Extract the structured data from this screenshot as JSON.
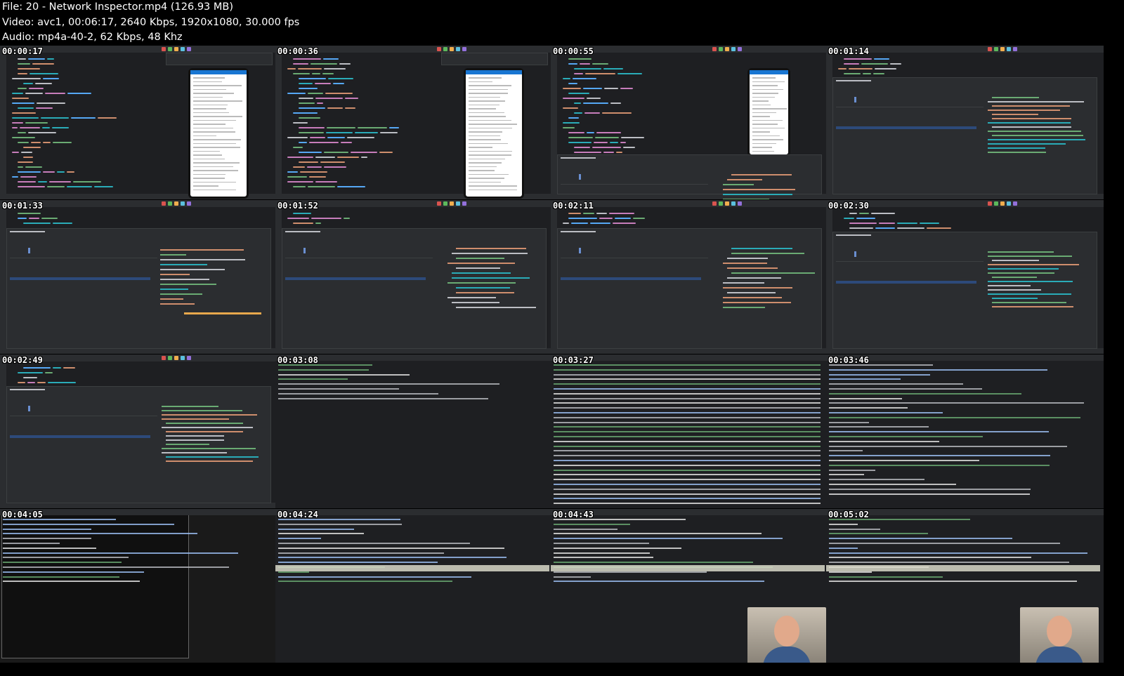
{
  "file_info": {
    "file": "File: 20 - Network Inspector.mp4 (126.93 MB)",
    "video": "Video: avc1, 00:06:17, 2640 Kbps, 1920x1080, 30.000 fps",
    "audio": "Audio: mp4a-40-2, 62 Kbps, 48 Khz"
  },
  "thumbnails": [
    {
      "timestamp": "00:00:17",
      "kind": "ide-code-phone"
    },
    {
      "timestamp": "00:00:36",
      "kind": "ide-code-phone"
    },
    {
      "timestamp": "00:00:55",
      "kind": "ide-code-phone-small"
    },
    {
      "timestamp": "00:01:14",
      "kind": "ide-inspector-json"
    },
    {
      "timestamp": "00:01:33",
      "kind": "ide-inspector-overview"
    },
    {
      "timestamp": "00:01:52",
      "kind": "ide-inspector-body"
    },
    {
      "timestamp": "00:02:11",
      "kind": "ide-inspector-body"
    },
    {
      "timestamp": "00:02:30",
      "kind": "ide-inspector-json"
    },
    {
      "timestamp": "00:02:49",
      "kind": "ide-inspector-json"
    },
    {
      "timestamp": "00:03:08",
      "kind": "terminal-short"
    },
    {
      "timestamp": "00:03:27",
      "kind": "terminal-dense"
    },
    {
      "timestamp": "00:03:46",
      "kind": "terminal-json"
    },
    {
      "timestamp": "00:04:05",
      "kind": "terminal-popup"
    },
    {
      "timestamp": "00:04:24",
      "kind": "terminal-curl"
    },
    {
      "timestamp": "00:04:43",
      "kind": "terminal-curl-face"
    },
    {
      "timestamp": "00:05:02",
      "kind": "terminal-curl-face"
    }
  ]
}
